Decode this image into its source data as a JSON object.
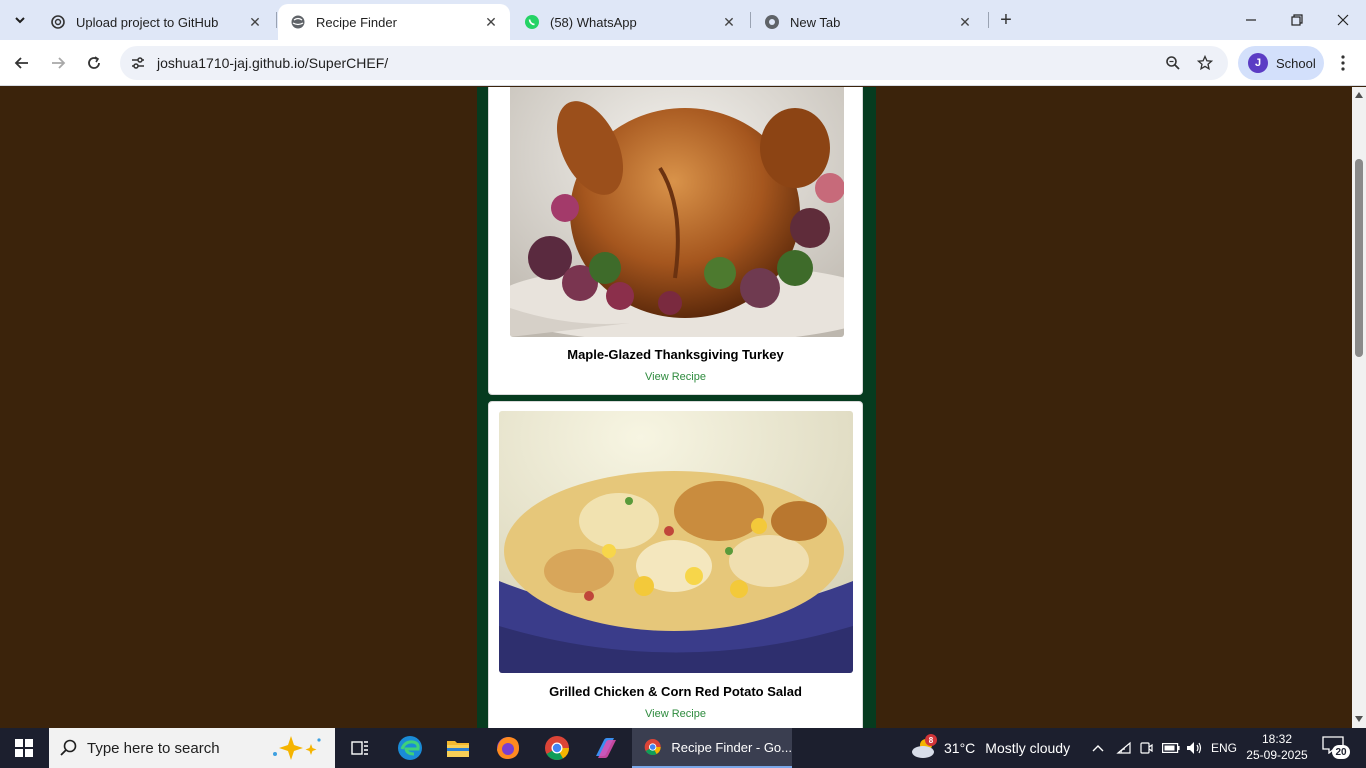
{
  "browser": {
    "tabs": [
      {
        "title": "Upload project to GitHub",
        "icon": "openai-icon",
        "active": false
      },
      {
        "title": "Recipe Finder",
        "icon": "globe-icon",
        "active": true
      },
      {
        "title": "(58) WhatsApp",
        "icon": "whatsapp-icon",
        "active": false
      },
      {
        "title": "New Tab",
        "icon": "chrome-icon",
        "active": false
      }
    ],
    "url": "joshua1710-jaj.github.io/SuperCHEF/",
    "profile": {
      "initial": "J",
      "label": "School"
    }
  },
  "page": {
    "recipes": [
      {
        "title": "Maple-Glazed Thanksgiving Turkey",
        "link": "View Recipe"
      },
      {
        "title": "Grilled Chicken & Corn Red Potato Salad",
        "link": "View Recipe"
      }
    ],
    "colors": {
      "background": "#3b230b",
      "column": "#063b1f",
      "link": "#2e8b3e"
    }
  },
  "taskbar": {
    "search_placeholder": "Type here to search",
    "active_window": "Recipe Finder - Go...",
    "weather": {
      "temp": "31°C",
      "condition": "Mostly cloudy",
      "badge": "8"
    },
    "language": "ENG",
    "time": "18:32",
    "date": "25-09-2025",
    "notifications": "20"
  }
}
